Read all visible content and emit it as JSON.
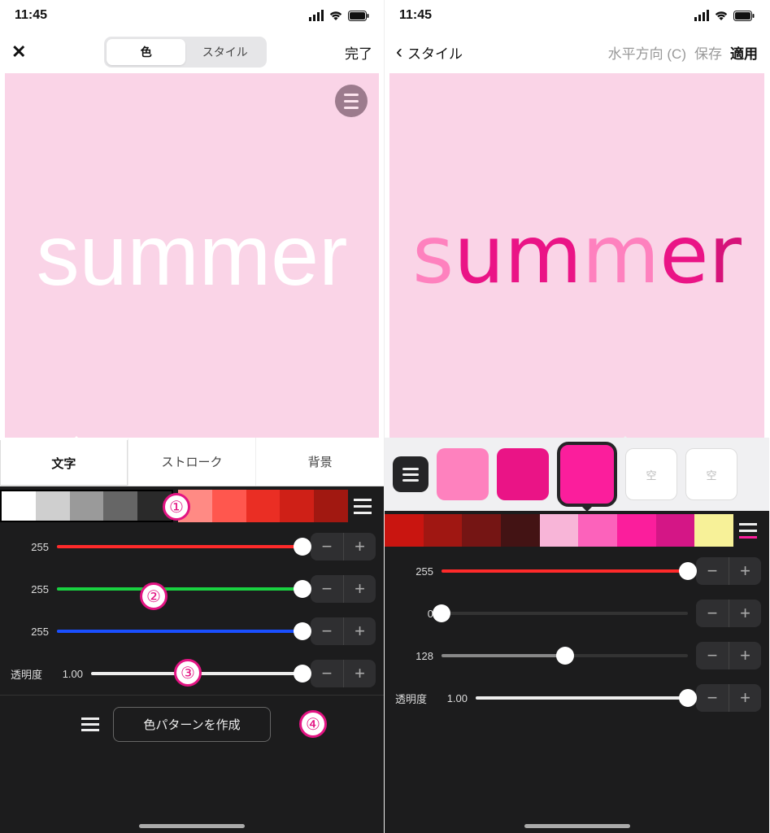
{
  "status": {
    "time": "11:45"
  },
  "left": {
    "nav": {
      "close": "✕",
      "seg_color": "色",
      "seg_style": "スタイル",
      "done": "完了"
    },
    "canvas_text": "summer",
    "subtabs": {
      "text": "文字",
      "stroke": "ストローク",
      "bg": "背景"
    },
    "grays": [
      "#ffffff",
      "#cfcfcf",
      "#9a9a9a",
      "#666666",
      "#2a2a2a"
    ],
    "reds": [
      "#ff8a84",
      "#ff574e",
      "#ea2e24",
      "#cf2017",
      "#a11811"
    ],
    "sliders": {
      "r": {
        "label": "255",
        "value": 255,
        "max": 255,
        "color": "#ff2a2a"
      },
      "g": {
        "label": "255",
        "value": 255,
        "max": 255,
        "color": "#19d140"
      },
      "b": {
        "label": "255",
        "value": 255,
        "max": 255,
        "color": "#1a4fff"
      },
      "a": {
        "label": "透明度",
        "value_text": "1.00",
        "value": 1.0,
        "max": 1.0
      }
    },
    "create_pattern": "色パターンを作成",
    "annot": {
      "one": "①",
      "two": "②",
      "three": "③",
      "four": "④"
    }
  },
  "right": {
    "nav": {
      "back": "スタイル",
      "horiz": "水平方向 (C)",
      "save": "保存",
      "apply": "適用"
    },
    "canvas_text": [
      "s",
      "u",
      "m",
      "m",
      "e",
      "r"
    ],
    "swatches": [
      "#fe81be",
      "#ea1486",
      "#fb1e9c"
    ],
    "empty_label": "空",
    "history": [
      "#c91510",
      "#a01712",
      "#751514",
      "#431314",
      "#f8b5d8",
      "#fc62bb",
      "#fb1e9c",
      "#d41686",
      "#f7f198"
    ],
    "sliders": {
      "r": {
        "label": "255",
        "value": 255,
        "max": 255,
        "color": "#ff2a2a"
      },
      "g": {
        "label": "0",
        "value": 0,
        "max": 255,
        "color": "#7a7a7a"
      },
      "b": {
        "label": "128",
        "value": 128,
        "max": 255,
        "color": "#9a9a9a"
      },
      "a": {
        "label": "透明度",
        "value_text": "1.00",
        "value": 1.0,
        "max": 1.0
      }
    }
  }
}
